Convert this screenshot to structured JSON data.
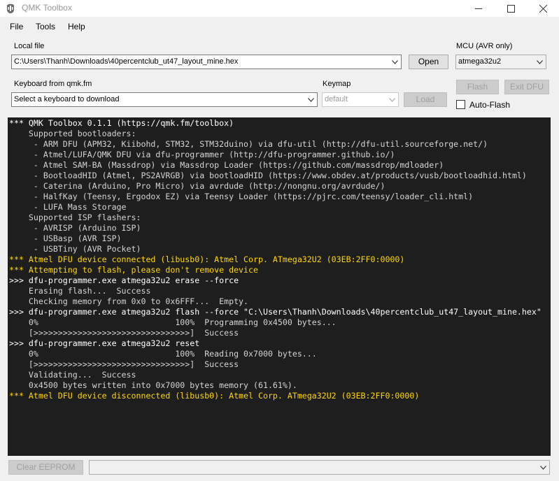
{
  "window": {
    "title": "QMK Toolbox"
  },
  "menu": [
    "File",
    "Tools",
    "Help"
  ],
  "local_file": {
    "label": "Local file",
    "path": "C:\\Users\\Thanh\\Downloads\\40percentclub_ut47_layout_mine.hex",
    "open_label": "Open"
  },
  "mcu": {
    "label": "MCU (AVR only)",
    "value": "atmega32u2"
  },
  "keyboard": {
    "label": "Keyboard from qmk.fm",
    "placeholder": "Select a keyboard to download"
  },
  "keymap": {
    "label": "Keymap",
    "value": "default",
    "load_label": "Load"
  },
  "actions": {
    "flash_label": "Flash",
    "exit_dfu_label": "Exit DFU",
    "auto_flash_label": "Auto-Flash",
    "auto_flash_checked": false
  },
  "console": {
    "lines": [
      {
        "text": "*** QMK Toolbox 0.1.1 (https://qmk.fm/toolbox)",
        "color": "white"
      },
      {
        "text": "    Supported bootloaders:",
        "color": "gray"
      },
      {
        "text": "     - ARM DFU (APM32, Kiibohd, STM32, STM32duino) via dfu-util (http://dfu-util.sourceforge.net/)",
        "color": "gray"
      },
      {
        "text": "     - Atmel/LUFA/QMK DFU via dfu-programmer (http://dfu-programmer.github.io/)",
        "color": "gray"
      },
      {
        "text": "     - Atmel SAM-BA (Massdrop) via Massdrop Loader (https://github.com/massdrop/mdloader)",
        "color": "gray"
      },
      {
        "text": "     - BootloadHID (Atmel, PS2AVRGB) via bootloadHID (https://www.obdev.at/products/vusb/bootloadhid.html)",
        "color": "gray"
      },
      {
        "text": "     - Caterina (Arduino, Pro Micro) via avrdude (http://nongnu.org/avrdude/)",
        "color": "gray"
      },
      {
        "text": "     - HalfKay (Teensy, Ergodox EZ) via Teensy Loader (https://pjrc.com/teensy/loader_cli.html)",
        "color": "gray"
      },
      {
        "text": "     - LUFA Mass Storage",
        "color": "gray"
      },
      {
        "text": "    Supported ISP flashers:",
        "color": "gray"
      },
      {
        "text": "     - AVRISP (Arduino ISP)",
        "color": "gray"
      },
      {
        "text": "     - USBasp (AVR ISP)",
        "color": "gray"
      },
      {
        "text": "     - USBTiny (AVR Pocket)",
        "color": "gray"
      },
      {
        "text": "*** Atmel DFU device connected (libusb0): Atmel Corp. ATmega32U2 (03EB:2FF0:0000)",
        "color": "yellow"
      },
      {
        "text": "*** Attempting to flash, please don't remove device",
        "color": "yellow"
      },
      {
        "text": ">>> dfu-programmer.exe atmega32u2 erase --force",
        "color": "white"
      },
      {
        "text": "    Erasing flash...  Success",
        "color": "gray"
      },
      {
        "text": "    Checking memory from 0x0 to 0x6FFF...  Empty.",
        "color": "gray"
      },
      {
        "text": ">>> dfu-programmer.exe atmega32u2 flash --force \"C:\\Users\\Thanh\\Downloads\\40percentclub_ut47_layout_mine.hex\"",
        "color": "white"
      },
      {
        "text": "    0%                            100%  Programming 0x4500 bytes...",
        "color": "gray"
      },
      {
        "text": "    [>>>>>>>>>>>>>>>>>>>>>>>>>>>>>>>>]  Success",
        "color": "gray"
      },
      {
        "text": ">>> dfu-programmer.exe atmega32u2 reset",
        "color": "white"
      },
      {
        "text": "    0%                            100%  Reading 0x7000 bytes...",
        "color": "gray"
      },
      {
        "text": "    [>>>>>>>>>>>>>>>>>>>>>>>>>>>>>>>>]  Success",
        "color": "gray"
      },
      {
        "text": "    Validating...  Success",
        "color": "gray"
      },
      {
        "text": "    0x4500 bytes written into 0x7000 bytes memory (61.61%).",
        "color": "gray"
      },
      {
        "text": "*** Atmel DFU device disconnected (libusb0): Atmel Corp. ATmega32U2 (03EB:2FF0:0000)",
        "color": "yellow"
      }
    ]
  },
  "bottom": {
    "clear_eeprom_label": "Clear EEPROM",
    "device_select_value": ""
  },
  "colors": {
    "console_bg": "#1e1e1e",
    "info": "#ffd700",
    "command": "#ffffff",
    "output": "#d4d4d4"
  }
}
